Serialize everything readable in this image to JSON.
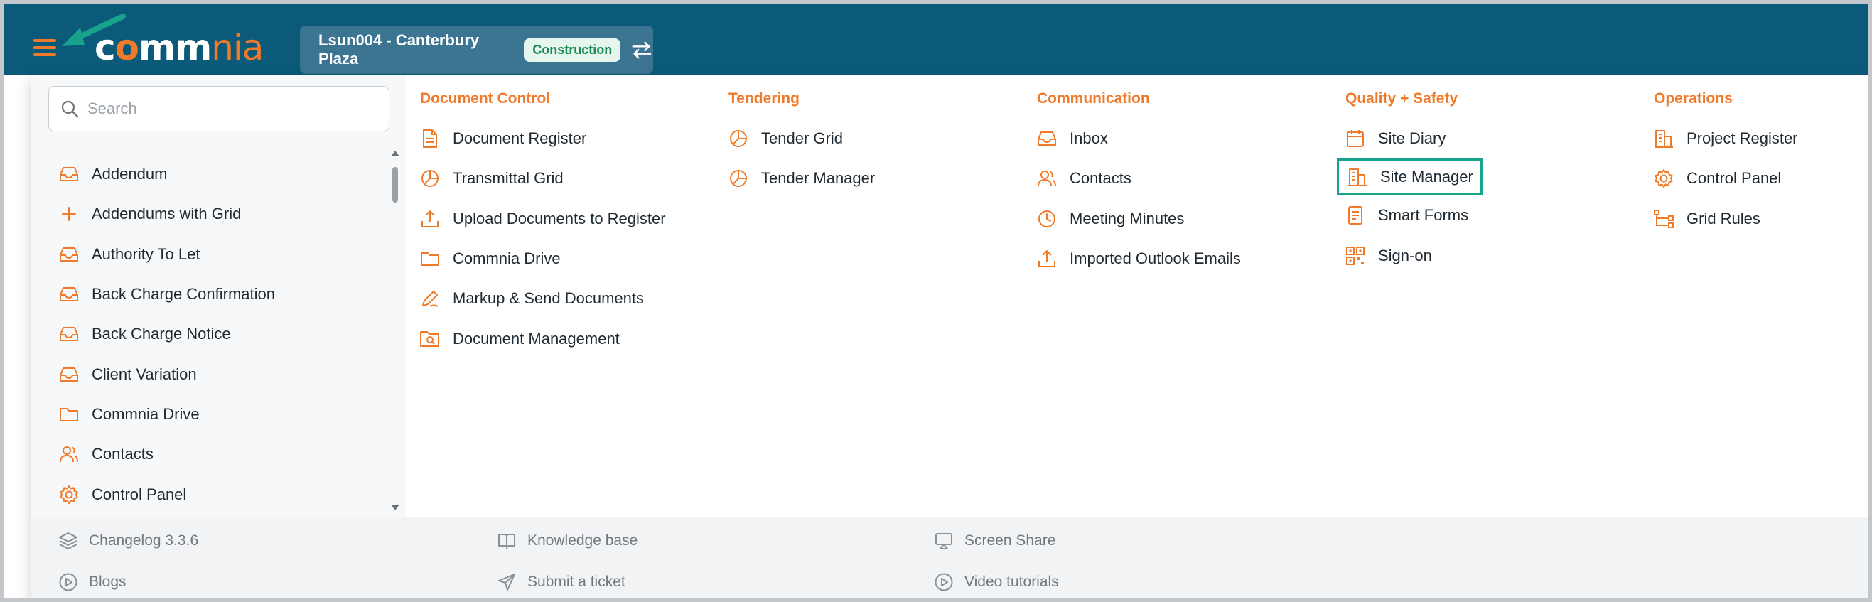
{
  "header": {
    "logo_left": "c",
    "logo_o": "o",
    "logo_mm": "mm",
    "logo_nia": "nia",
    "project_name": "Lsun004 - Canterbury Plaza",
    "project_badge": "Construction"
  },
  "search": {
    "placeholder": "Search"
  },
  "sidebar": {
    "items": [
      {
        "label": "Addendum",
        "icon": "inbox-icon"
      },
      {
        "label": "Addendums with Grid",
        "icon": "plus-icon"
      },
      {
        "label": "Authority To Let",
        "icon": "inbox-icon"
      },
      {
        "label": "Back Charge Confirmation",
        "icon": "inbox-icon"
      },
      {
        "label": "Back Charge Notice",
        "icon": "inbox-icon"
      },
      {
        "label": "Client Variation",
        "icon": "inbox-icon"
      },
      {
        "label": "Commnia Drive",
        "icon": "folder-icon"
      },
      {
        "label": "Contacts",
        "icon": "users-icon"
      },
      {
        "label": "Control Panel",
        "icon": "gear-icon"
      }
    ]
  },
  "columns": [
    {
      "title": "Document Control",
      "items": [
        {
          "label": "Document Register",
          "icon": "document-icon"
        },
        {
          "label": "Transmittal Grid",
          "icon": "pie-chart-icon"
        },
        {
          "label": "Upload Documents to Register",
          "icon": "upload-icon"
        },
        {
          "label": "Commnia Drive",
          "icon": "folder-icon"
        },
        {
          "label": "Markup & Send Documents",
          "icon": "pen-icon"
        },
        {
          "label": "Document Management",
          "icon": "folder-search-icon"
        }
      ]
    },
    {
      "title": "Tendering",
      "items": [
        {
          "label": "Tender Grid",
          "icon": "pie-chart-icon"
        },
        {
          "label": "Tender Manager",
          "icon": "pie-chart-icon"
        }
      ]
    },
    {
      "title": "Communication",
      "items": [
        {
          "label": "Inbox",
          "icon": "inbox-icon"
        },
        {
          "label": "Contacts",
          "icon": "users-icon"
        },
        {
          "label": "Meeting Minutes",
          "icon": "clock-icon"
        },
        {
          "label": "Imported Outlook Emails",
          "icon": "upload-icon"
        }
      ]
    },
    {
      "title": "Quality + Safety",
      "items": [
        {
          "label": "Site Diary",
          "icon": "calendar-icon"
        },
        {
          "label": "Site Manager",
          "icon": "building-icon"
        },
        {
          "label": "Smart Forms",
          "icon": "form-icon"
        },
        {
          "label": "Sign-on",
          "icon": "qr-code-icon"
        }
      ]
    },
    {
      "title": "Operations",
      "items": [
        {
          "label": "Project Register",
          "icon": "building-icon"
        },
        {
          "label": "Control Panel",
          "icon": "gear-icon"
        },
        {
          "label": "Grid Rules",
          "icon": "workflow-icon"
        }
      ]
    }
  ],
  "footer": {
    "changelog": "Changelog 3.3.6",
    "blogs": "Blogs",
    "knowledge_base": "Knowledge base",
    "submit_ticket": "Submit a ticket",
    "screen_share": "Screen Share",
    "video_tutorials": "Video tutorials"
  },
  "colors": {
    "header_bg": "#0b5a7a",
    "accent_orange": "#f07a2a",
    "highlight_teal": "#17a38b",
    "badge_green": "#1d8a55"
  }
}
